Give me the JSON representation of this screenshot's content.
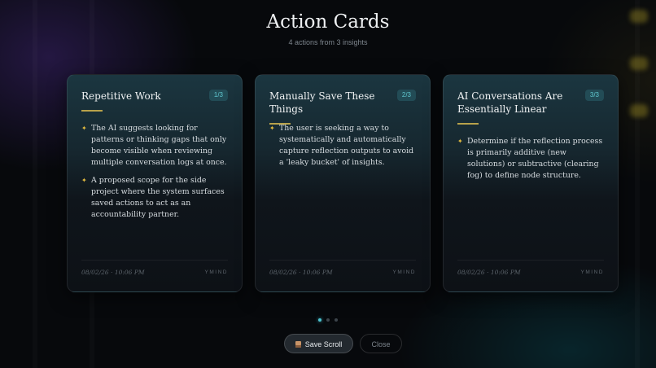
{
  "header": {
    "title": "Action Cards",
    "subtitle": "4 actions from 3 insights"
  },
  "cards": [
    {
      "title": "Repetitive Work",
      "badge": "1/3",
      "bullets": [
        "The AI suggests looking for patterns or thinking gaps that only become visible when reviewing multiple conversation logs at once.",
        "A proposed scope for the side project where the system surfaces saved actions to act as an accountability partner."
      ],
      "date": "08/02/26 · 10:06 PM",
      "brand": "YMIND"
    },
    {
      "title": "Manually Save These Things",
      "badge": "2/3",
      "bullets": [
        "The user is seeking a way to systematically and automatically capture reflection outputs to avoid a 'leaky bucket' of insights."
      ],
      "date": "08/02/26 · 10:06 PM",
      "brand": "YMIND"
    },
    {
      "title": "AI Conversations Are Essentially Linear",
      "badge": "3/3",
      "bullets": [
        "Determine if the reflection process is primarily additive (new solutions) or subtractive (clearing fog) to define node structure."
      ],
      "date": "08/02/26 · 10:06 PM",
      "brand": "YMIND"
    }
  ],
  "pagination": {
    "total": 3,
    "active": 0
  },
  "actions": {
    "save_icon": "scroll-icon",
    "save_label": "Save Scroll",
    "close_label": "Close"
  },
  "colors": {
    "accent": "#4cc3d0",
    "gold": "#e0b93f",
    "rule": "#b8a24a"
  }
}
